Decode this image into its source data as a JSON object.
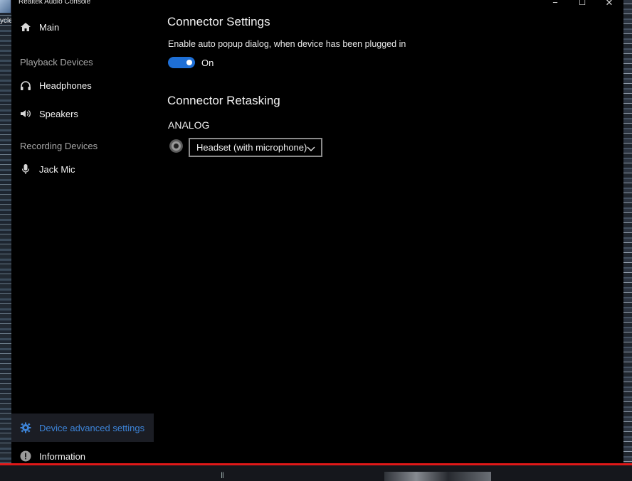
{
  "desktop": {
    "icon_label": "ycle"
  },
  "window": {
    "title": "Realtek Audio Console",
    "minimize": "−",
    "maximize": "☐",
    "close": "✕"
  },
  "sidebar": {
    "main_label": "Main",
    "playback_header": "Playback Devices",
    "playback_items": [
      {
        "label": "Headphones",
        "icon": "headphones-icon"
      },
      {
        "label": "Speakers",
        "icon": "speaker-icon"
      }
    ],
    "recording_header": "Recording Devices",
    "recording_items": [
      {
        "label": "Jack Mic",
        "icon": "microphone-icon"
      }
    ],
    "device_advanced_label": "Device advanced settings",
    "information_label": "Information"
  },
  "main": {
    "connector_settings_title": "Connector Settings",
    "auto_popup_description": "Enable auto popup dialog, when device has been plugged in",
    "auto_popup_toggle": {
      "state": "On"
    },
    "connector_retasking_title": "Connector Retasking",
    "analog_label": "ANALOG",
    "jack_select_value": "Headset (with microphone)"
  },
  "colors": {
    "accent": "#1e6fd6",
    "active_nav_text": "#3d84d8",
    "background": "#000000",
    "alert_line": "#e01818"
  }
}
